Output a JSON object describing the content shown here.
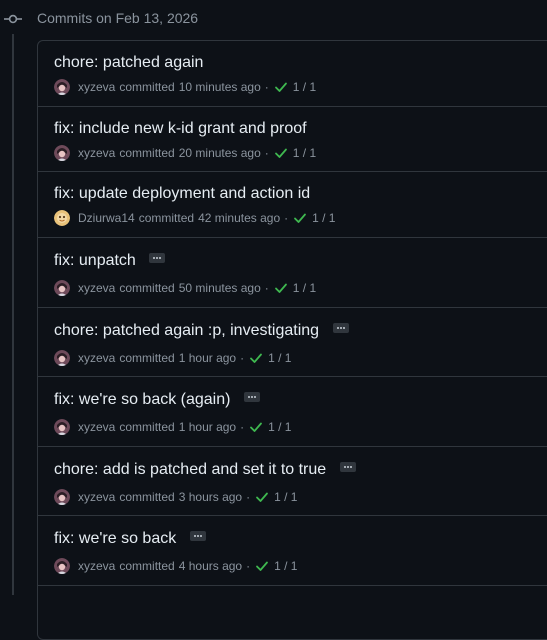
{
  "day": {
    "title": "Commits on Feb 13, 2026"
  },
  "labels": {
    "committed": "committed",
    "separator": "·"
  },
  "colors": {
    "check": "#3fb950",
    "background": "#0d1117",
    "border": "#30363d"
  },
  "commits": [
    {
      "title": "chore: patched again",
      "author": "xyzeva",
      "time": "10 minutes ago",
      "status": "1 / 1",
      "has_ellipsis": false,
      "avatar": "avatar-xyzeva"
    },
    {
      "title": "fix: include new k-id grant and proof",
      "author": "xyzeva",
      "time": "20 minutes ago",
      "status": "1 / 1",
      "has_ellipsis": false,
      "avatar": "avatar-xyzeva"
    },
    {
      "title": "fix: update deployment and action id",
      "author": "Dziurwa14",
      "time": "42 minutes ago",
      "status": "1 / 1",
      "has_ellipsis": false,
      "avatar": "avatar-dziurwa14"
    },
    {
      "title": "fix: unpatch",
      "author": "xyzeva",
      "time": "50 minutes ago",
      "status": "1 / 1",
      "has_ellipsis": true,
      "avatar": "avatar-xyzeva"
    },
    {
      "title": "chore: patched again :p, investigating",
      "author": "xyzeva",
      "time": "1 hour ago",
      "status": "1 / 1",
      "has_ellipsis": true,
      "avatar": "avatar-xyzeva"
    },
    {
      "title": "fix: we're so back (again)",
      "author": "xyzeva",
      "time": "1 hour ago",
      "status": "1 / 1",
      "has_ellipsis": true,
      "avatar": "avatar-xyzeva"
    },
    {
      "title": "chore: add is patched and set it to true",
      "author": "xyzeva",
      "time": "3 hours ago",
      "status": "1 / 1",
      "has_ellipsis": true,
      "avatar": "avatar-xyzeva"
    },
    {
      "title": "fix: we're so back",
      "author": "xyzeva",
      "time": "4 hours ago",
      "status": "1 / 1",
      "has_ellipsis": true,
      "avatar": "avatar-xyzeva"
    }
  ]
}
